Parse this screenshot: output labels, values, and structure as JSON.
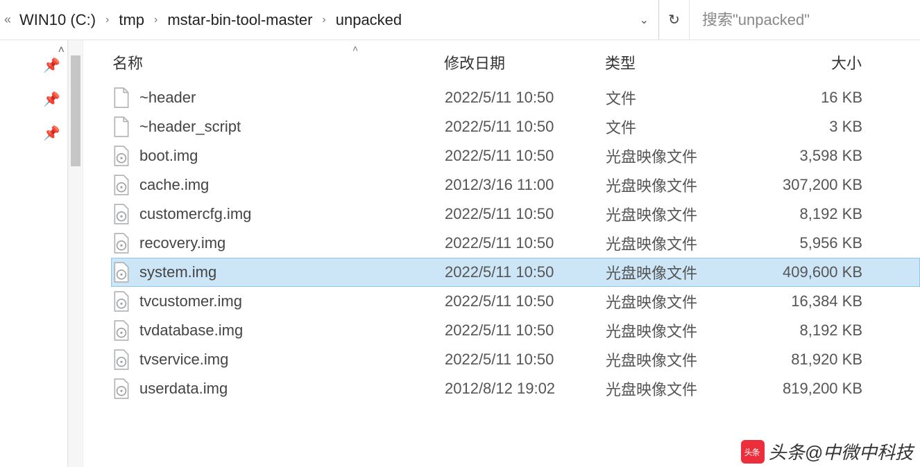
{
  "breadcrumb": {
    "items": [
      "WIN10 (C:)",
      "tmp",
      "mstar-bin-tool-master",
      "unpacked"
    ]
  },
  "search": {
    "placeholder": "搜索\"unpacked\""
  },
  "columns": {
    "name": "名称",
    "date": "修改日期",
    "type": "类型",
    "size": "大小"
  },
  "files": [
    {
      "icon": "file",
      "name": "~header",
      "date": "2022/5/11 10:50",
      "type": "文件",
      "size": "16 KB",
      "selected": false
    },
    {
      "icon": "file",
      "name": "~header_script",
      "date": "2022/5/11 10:50",
      "type": "文件",
      "size": "3 KB",
      "selected": false
    },
    {
      "icon": "disc",
      "name": "boot.img",
      "date": "2022/5/11 10:50",
      "type": "光盘映像文件",
      "size": "3,598 KB",
      "selected": false
    },
    {
      "icon": "disc",
      "name": "cache.img",
      "date": "2012/3/16 11:00",
      "type": "光盘映像文件",
      "size": "307,200 KB",
      "selected": false
    },
    {
      "icon": "disc",
      "name": "customercfg.img",
      "date": "2022/5/11 10:50",
      "type": "光盘映像文件",
      "size": "8,192 KB",
      "selected": false
    },
    {
      "icon": "disc",
      "name": "recovery.img",
      "date": "2022/5/11 10:50",
      "type": "光盘映像文件",
      "size": "5,956 KB",
      "selected": false
    },
    {
      "icon": "disc",
      "name": "system.img",
      "date": "2022/5/11 10:50",
      "type": "光盘映像文件",
      "size": "409,600 KB",
      "selected": true
    },
    {
      "icon": "disc",
      "name": "tvcustomer.img",
      "date": "2022/5/11 10:50",
      "type": "光盘映像文件",
      "size": "16,384 KB",
      "selected": false
    },
    {
      "icon": "disc",
      "name": "tvdatabase.img",
      "date": "2022/5/11 10:50",
      "type": "光盘映像文件",
      "size": "8,192 KB",
      "selected": false
    },
    {
      "icon": "disc",
      "name": "tvservice.img",
      "date": "2022/5/11 10:50",
      "type": "光盘映像文件",
      "size": "81,920 KB",
      "selected": false
    },
    {
      "icon": "disc",
      "name": "userdata.img",
      "date": "2012/8/12 19:02",
      "type": "光盘映像文件",
      "size": "819,200 KB",
      "selected": false
    }
  ],
  "watermark": "头条@中微中科技"
}
